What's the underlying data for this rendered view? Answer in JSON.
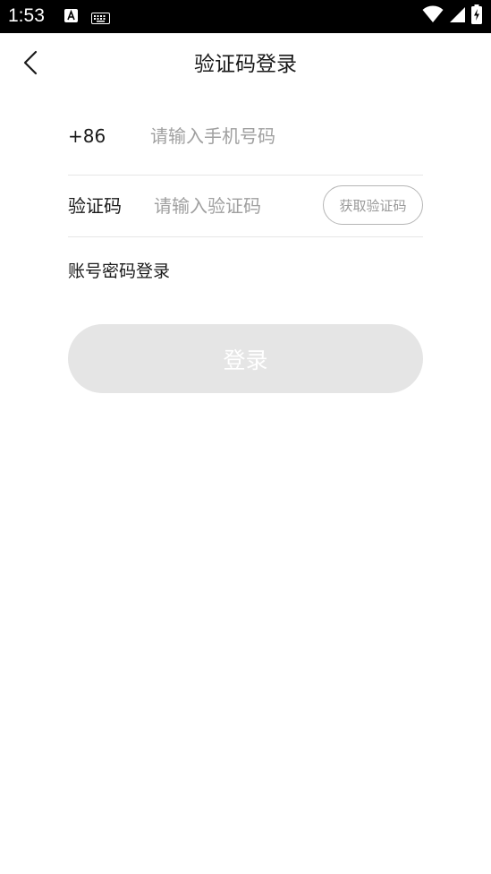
{
  "status_bar": {
    "time": "1:53",
    "left_icons": [
      "a-letter-notification-icon",
      "keyboard-icon"
    ],
    "right_icons": [
      "wifi-icon",
      "signal-icon",
      "battery-charging-icon"
    ]
  },
  "header": {
    "title": "验证码登录",
    "back_icon": "chevron-left-icon"
  },
  "form": {
    "country_code": "+86",
    "phone_placeholder": "请输入手机号码",
    "phone_value": "",
    "code_label": "验证码",
    "code_placeholder": "请输入验证码",
    "code_value": "",
    "get_code_label": "获取验证码"
  },
  "password_login_link": "账号密码登录",
  "login_button_label": "登录",
  "colors": {
    "status_bar_bg": "#000000",
    "login_button_bg": "#e5e5e5",
    "placeholder": "#a0a0a0",
    "divider": "#e6e6e6",
    "outline_button_border": "#b5b5b5"
  }
}
